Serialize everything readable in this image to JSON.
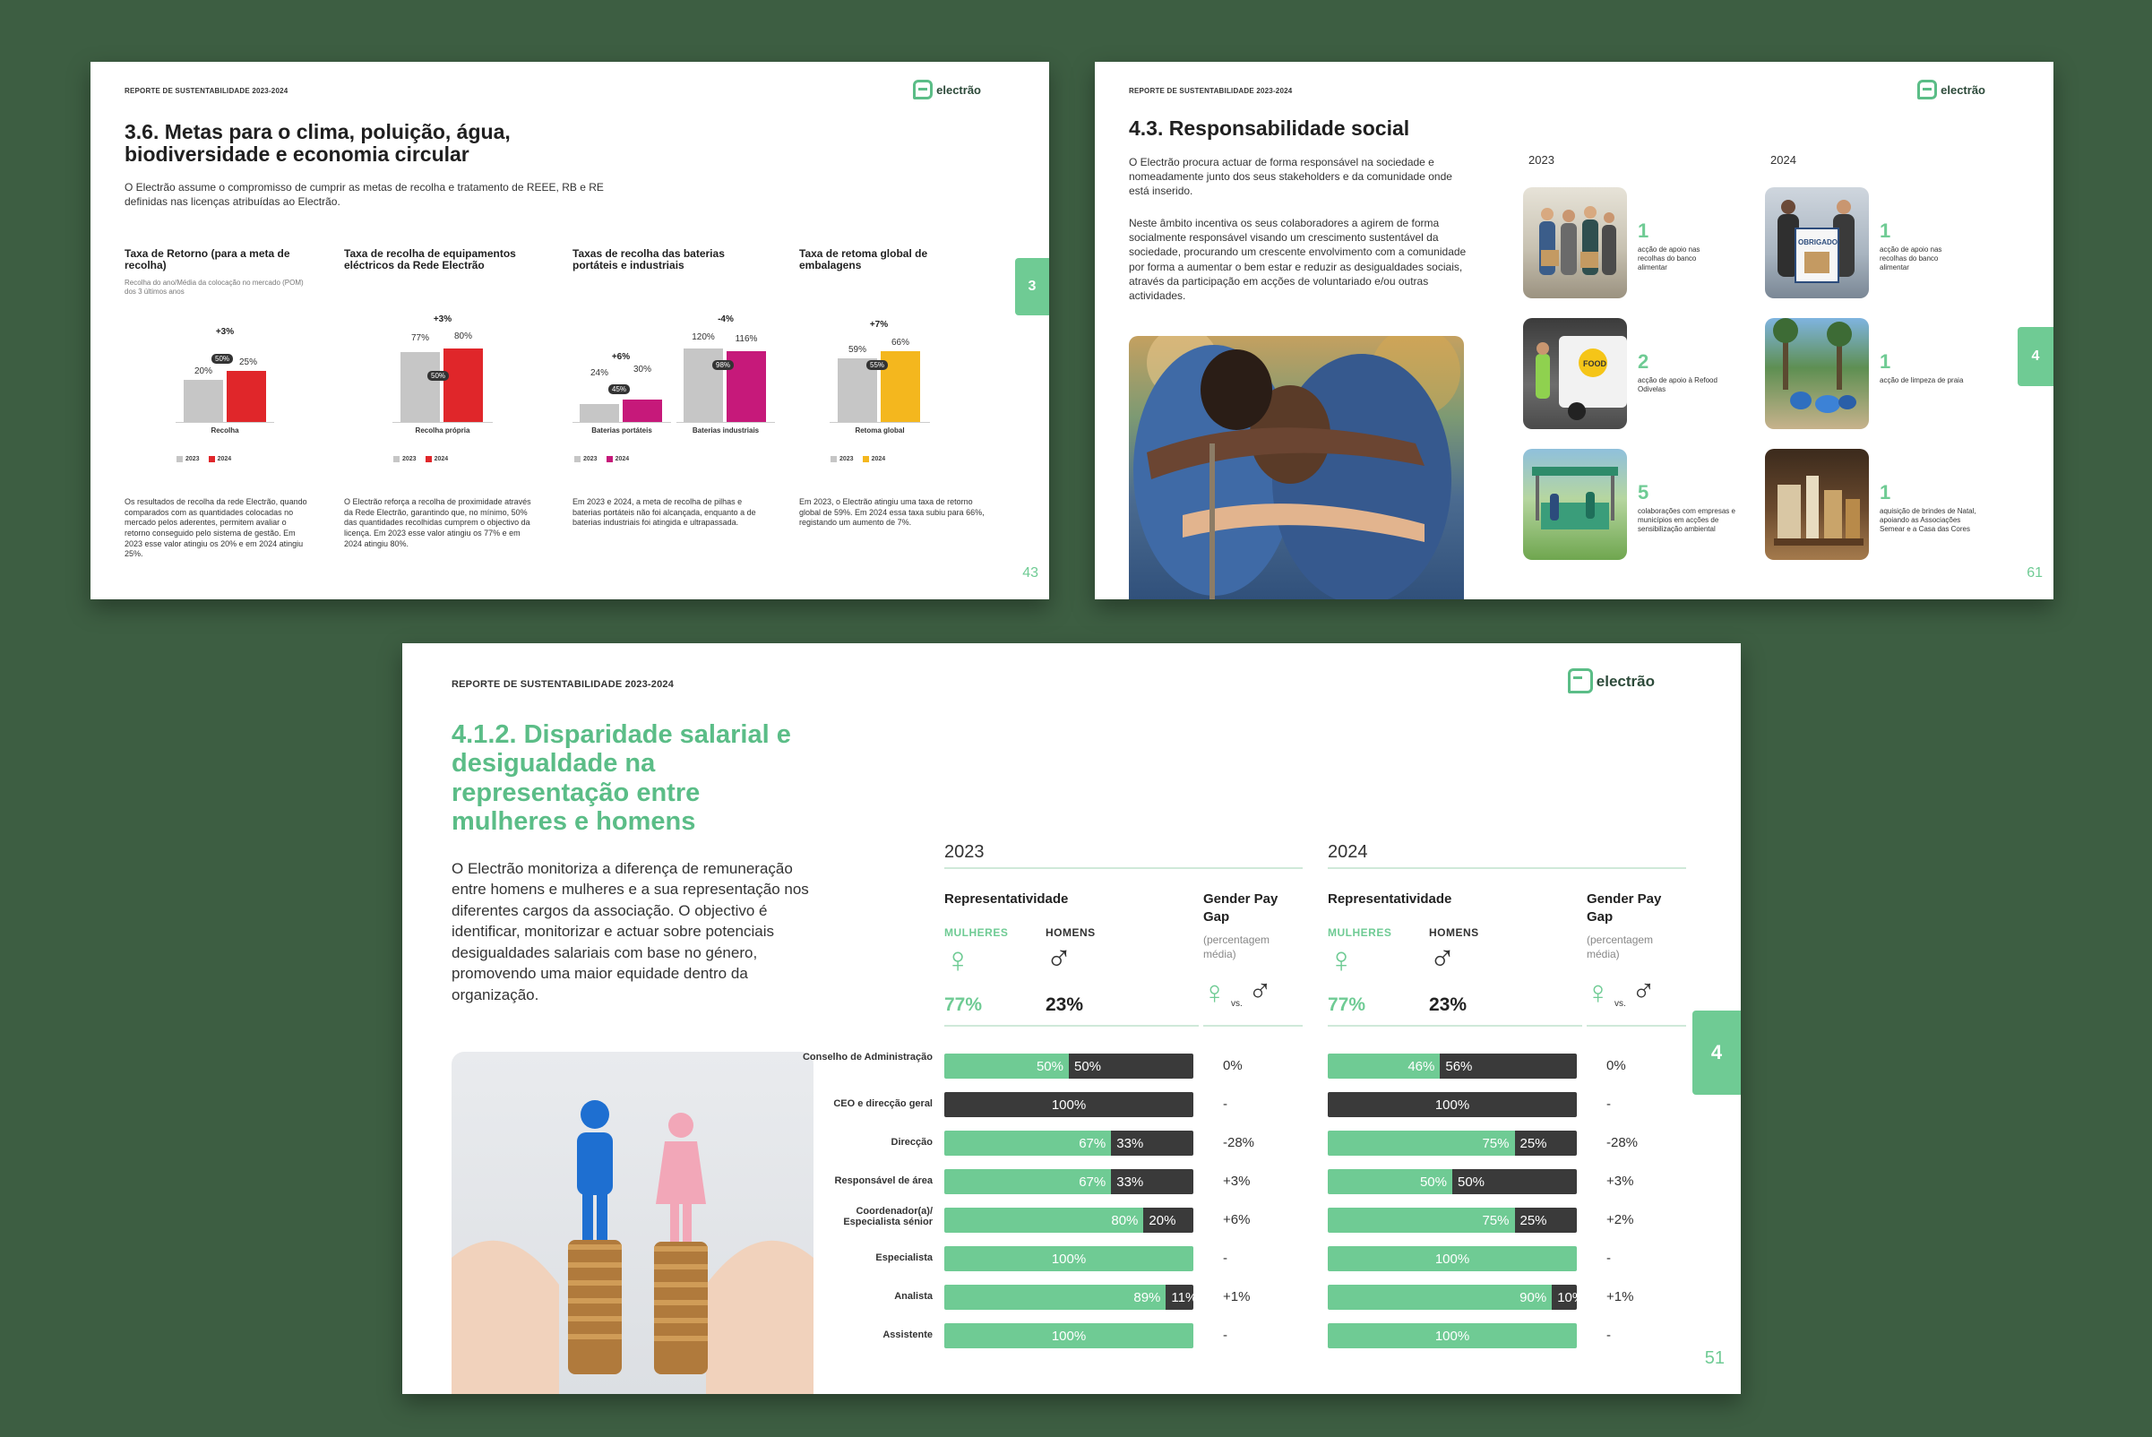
{
  "colors": {
    "background": "#3d5e42",
    "accent": "#6fcb94",
    "red": "#e0262a",
    "magenta": "#c6197a",
    "yellow": "#f4b71e",
    "dark": "#3a3a3a",
    "grey": "#c6c6c6"
  },
  "brand": {
    "name": "electrão"
  },
  "header": "REPORTE DE SUSTENTABILIDADE 2023-2024",
  "page1": {
    "title": "3.6. Metas para o clima, poluição, água, biodiversidade e economia circular",
    "intro": "O Electrão assume o compromisso de cumprir as metas de recolha e tratamento de REEE, RB e RE definidas nas licenças atribuídas ao Electrão.",
    "tab": "3",
    "page_number": "43",
    "legend": {
      "a": "2023",
      "b": "2024"
    },
    "charts": [
      {
        "title": "Taxa de Retorno (para a meta de recolha)",
        "subtitle": "Recolha do ano/Média da colocação no mercado (POM) dos 3 últimos anos",
        "text": "Os resultados de recolha da rede Electrão, quando comparados com as quantidades colocadas no mercado pelos aderentes, permitem avaliar o retorno conseguido pelo sistema de gestão. Em 2023 esse valor atingiu os 20% e em 2024 atingiu 25%."
      },
      {
        "title": "Taxa de recolha de equipamentos eléctricos da Rede Electrão",
        "subtitle": "",
        "text": "O Electrão reforça a recolha de proximidade através da Rede Electrão, garantindo que, no mínimo, 50% das quantidades recolhidas cumprem o objectivo da licença. Em 2023 esse valor atingiu os 77% e em 2024 atingiu 80%."
      },
      {
        "title": "Taxas de recolha das baterias portáteis e industriais",
        "subtitle": "",
        "text": "Em 2023 e 2024, a meta de recolha de pilhas e baterias portáteis não foi alcançada, enquanto a de baterias industriais foi atingida e ultrapassada."
      },
      {
        "title": "Taxa de retoma global de embalagens",
        "subtitle": "",
        "text": "Em 2023, o Electrão atingiu uma taxa de retorno global de 59%. Em 2024 essa taxa subiu para 66%, registando um aumento de 7%."
      }
    ]
  },
  "chart_data": [
    {
      "type": "bar",
      "categories": [
        "Recolha"
      ],
      "series": [
        {
          "name": "2023",
          "values": [
            20
          ]
        },
        {
          "name": "2024",
          "values": [
            25
          ]
        }
      ],
      "labels": [
        "20%",
        "25%"
      ],
      "target": "50%",
      "delta": "+3%",
      "ylim": [
        0,
        100
      ]
    },
    {
      "type": "bar",
      "categories": [
        "Recolha própria"
      ],
      "series": [
        {
          "name": "2023",
          "values": [
            77
          ]
        },
        {
          "name": "2024",
          "values": [
            80
          ]
        }
      ],
      "labels": [
        "77%",
        "80%"
      ],
      "target": "50%",
      "delta": "+3%",
      "ylim": [
        0,
        100
      ]
    },
    {
      "type": "bar",
      "categories": [
        "Baterias portáteis",
        "Baterias industriais"
      ],
      "series": [
        {
          "name": "2023",
          "values": [
            24,
            120
          ]
        },
        {
          "name": "2024",
          "values": [
            30,
            116
          ]
        }
      ],
      "labels": [
        [
          "24%",
          "30%"
        ],
        [
          "120%",
          "116%"
        ]
      ],
      "target": [
        "45%",
        "98%"
      ],
      "delta": [
        "+6%",
        "-4%"
      ],
      "ylim": [
        0,
        150
      ]
    },
    {
      "type": "bar",
      "categories": [
        "Retoma global"
      ],
      "series": [
        {
          "name": "2023",
          "values": [
            59
          ]
        },
        {
          "name": "2024",
          "values": [
            66
          ]
        }
      ],
      "labels": [
        "59%",
        "66%"
      ],
      "target": "55%",
      "delta": "+7%",
      "ylim": [
        0,
        100
      ]
    }
  ],
  "page2": {
    "title": "4.3. Responsabilidade social",
    "p1": "O Electrão procura actuar de forma responsável na sociedade e nomeadamente junto dos seus stakeholders e da comunidade onde está inserido.",
    "p2": "Neste âmbito incentiva os seus colaboradores a agirem de forma socialmente responsável visando um crescimento sustentável da sociedade, procurando um crescente envolvimento com a comunidade por forma a aumentar o bem estar e reduzir as desigualdades sociais, através da participação em acções de voluntariado e/ou outras actividades.",
    "year_a": "2023",
    "year_b": "2024",
    "tab": "4",
    "page_number": "61",
    "items_2023": [
      {
        "num": "1",
        "desc": "acção de apoio nas recolhas do banco alimentar"
      },
      {
        "num": "2",
        "desc": "acção de apoio à Refood Odivelas"
      },
      {
        "num": "5",
        "desc": "colaborações com empresas e municípios em acções de sensibilização ambiental"
      }
    ],
    "items_2024": [
      {
        "num": "1",
        "desc": "acção de apoio nas recolhas do banco alimentar"
      },
      {
        "num": "1",
        "desc": "acção de limpeza de praia"
      },
      {
        "num": "1",
        "desc": "aquisição de brindes de Natal, apoiando as Associações Semear e a Casa das Cores"
      }
    ],
    "sign_text": "OBRIGADO",
    "van_text": "FOOD"
  },
  "page3": {
    "title": "4.1.2. Disparidade salarial e desigualdade na representação entre mulheres e homens",
    "intro": "O Electrão monitoriza a diferença de remuneração entre homens e mulheres e a sua representação nos diferentes cargos da associação. O objectivo é identificar, monitorizar e actuar sobre potenciais desigualdades salariais com base no género, promovendo uma maior equidade dentro da organização.",
    "tab": "4",
    "page_number": "51",
    "rep_label": "Representatividade",
    "gap_label": "Gender Pay Gap",
    "gap_sub": "(percentagem média)",
    "women_label": "MULHERES",
    "men_label": "HOMENS",
    "vs": "vs.",
    "years": [
      {
        "year": "2023",
        "women_pct": "77%",
        "men_pct": "23%"
      },
      {
        "year": "2024",
        "women_pct": "77%",
        "men_pct": "23%"
      }
    ],
    "rows": [
      {
        "label": "Conselho de Administração",
        "y2023": {
          "w": 50,
          "m": 50,
          "gap": "0%"
        },
        "y2024": {
          "w": 46,
          "m": 56,
          "gap": "0%"
        }
      },
      {
        "label": "CEO e direcção geral",
        "y2023": {
          "w": 0,
          "m": 100,
          "gap": "-"
        },
        "y2024": {
          "w": 0,
          "m": 100,
          "gap": "-"
        }
      },
      {
        "label": "Direcção",
        "y2023": {
          "w": 67,
          "m": 33,
          "gap": "-28%"
        },
        "y2024": {
          "w": 75,
          "m": 25,
          "gap": "-28%"
        }
      },
      {
        "label": "Responsável de área",
        "y2023": {
          "w": 67,
          "m": 33,
          "gap": "+3%"
        },
        "y2024": {
          "w": 50,
          "m": 50,
          "gap": "+3%"
        }
      },
      {
        "label": "Coordenador(a)/ Especialista sénior",
        "y2023": {
          "w": 80,
          "m": 20,
          "gap": "+6%"
        },
        "y2024": {
          "w": 75,
          "m": 25,
          "gap": "+2%"
        }
      },
      {
        "label": "Especialista",
        "y2023": {
          "w": 100,
          "m": 0,
          "gap": "-"
        },
        "y2024": {
          "w": 100,
          "m": 0,
          "gap": "-"
        }
      },
      {
        "label": "Analista",
        "y2023": {
          "w": 89,
          "m": 11,
          "gap": "+1%"
        },
        "y2024": {
          "w": 90,
          "m": 10,
          "gap": "+1%"
        }
      },
      {
        "label": "Assistente",
        "y2023": {
          "w": 100,
          "m": 0,
          "gap": "-"
        },
        "y2024": {
          "w": 100,
          "m": 0,
          "gap": "-"
        }
      }
    ]
  }
}
